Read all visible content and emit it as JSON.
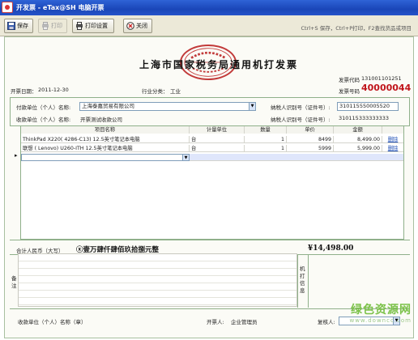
{
  "window": {
    "title": "开发票 - eTax@SH 电脑开票"
  },
  "toolbar": {
    "save": "保存",
    "print": "打印",
    "print_settings": "打印设置",
    "close": "关闭",
    "hint": "Ctrl+S 保存，Ctrl+P打印，F2查找货品或项目"
  },
  "invoice": {
    "title": "上海市国家税务局通用机打发票",
    "code_label": "发票代码",
    "code_value": "131001101251",
    "number_label": "发票号码",
    "number_value": "40000044",
    "date_label": "开票日期：",
    "date_value": "2011-12-30",
    "industry_label": "行业分类：",
    "industry_value": "工业",
    "payer_label": "付款单位（个人）名称:",
    "payer_value": "上海泰嘉贸易有限公司",
    "payer_tax_label": "纳税人识别号（证件号）:",
    "payer_tax_value": "310115550005520",
    "payee_label": "收款单位（个人）名称:",
    "payee_value": "开票测试收款公司",
    "payee_tax_label": "纳税人识别号（证件号）:",
    "payee_tax_value": "310115333333333",
    "columns": [
      "项目名称",
      "计量单位",
      "数量",
      "单价",
      "金额"
    ],
    "items": [
      {
        "name": "ThinkPad X220( 4286-C13) 12.5英寸笔记本电脑",
        "unit": "台",
        "qty": "1",
        "price": "8499",
        "amount": "8,499.00",
        "action": "删除"
      },
      {
        "name": "联想 ( Lenovo) U260-ITH 12.5英寸笔记本电脑",
        "unit": "台",
        "qty": "1",
        "price": "5999",
        "amount": "5,999.00",
        "action": "删除"
      }
    ],
    "row_marker": "▸",
    "total_label": "合计人民币（大写）",
    "total_caps": "ⓧ壹万肆仟肆佰玖拾捌元整",
    "total_amount": "¥14,498.00",
    "remark_label": "备注",
    "machine_label": "机打信息",
    "payee_sign_label": "收款单位（个人）名称（章）",
    "issuer_label": "开票人:",
    "issuer_value": "企业管理员",
    "recheck_label": "复核人:"
  },
  "watermark": {
    "line1": "绿色资源网",
    "line2": "www.downcc.com"
  },
  "colors": {
    "accent_red": "#c0141a",
    "link_blue": "#1f4fb5"
  }
}
